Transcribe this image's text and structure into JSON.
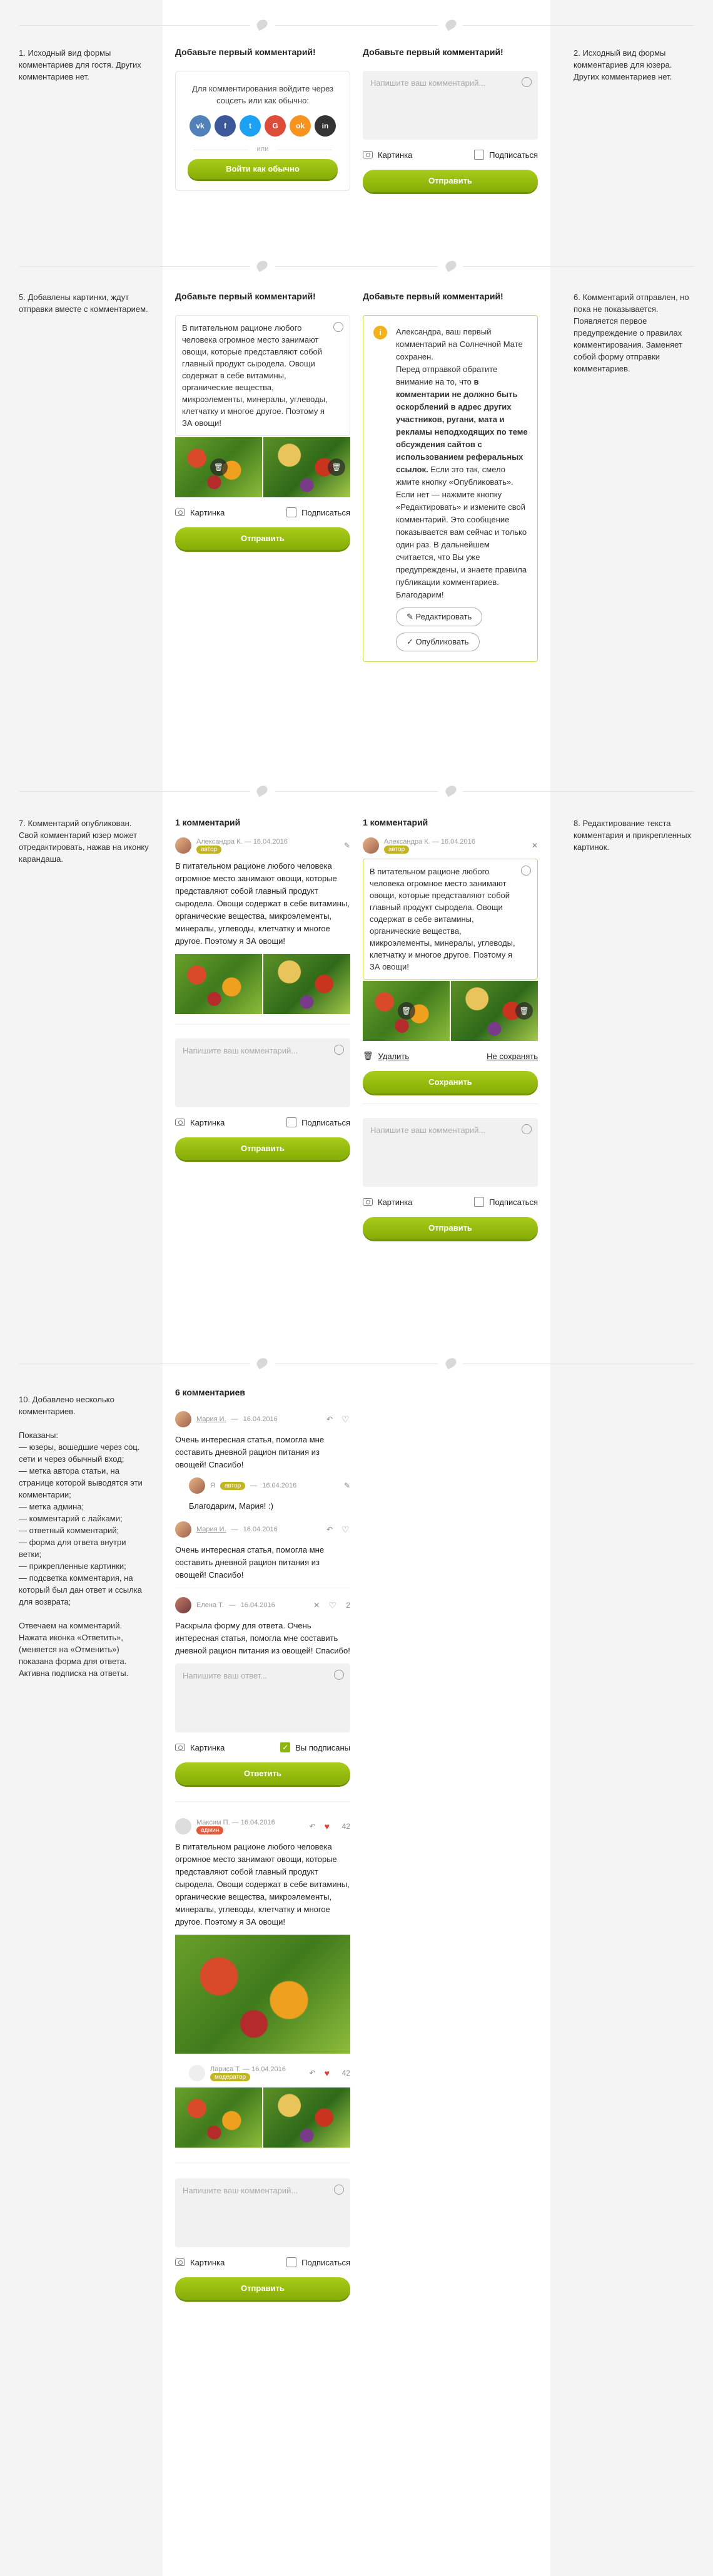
{
  "notes": {
    "n1": "1. Исходный вид формы комментариев для гостя. Других комментариев нет.",
    "n2": "2. Исходный вид формы комментариев для юзера. Других комментариев нет.",
    "n5": "5. Добавлены картинки, ждут отправки вместе с комментарием.",
    "n6": "6. Комментарий отправлен, но пока не показывается. Появляется первое предупреждение о правилах комментирования. Заменяет собой форму отправки комментариев.",
    "n7": "7. Комментарий опубликован. Свой комментарий юзер может отредактировать, нажав на иконку карандаша.",
    "n8": "8. Редактирование текста комментария и прикрепленных картинок.",
    "n10": "10. Добавлено несколько комментариев.\n\nПоказаны:\n— юзеры, вошедшие через соц. сети и через обычный вход;\n— метка автора статьи, на странице которой выводятся эти комментарии;\n— метка админа;\n— комментарий с лайками;\n— ответный комментарий;\n— форма для ответа внутри ветки;\n— прикрепленные картинки;\n— подсветка комментария, на который был дан ответ и ссылка для возврата;\n\nОтвечаем на комментарий. Нажата иконка «Ответить», (меняется на «Отменить») показана форма для ответа. Активна подписка на ответы."
  },
  "common": {
    "first_title": "Добавьте первый комментарий!",
    "placeholder": "Напишите ваш комментарий...",
    "reply_placeholder": "Напишите ваш ответ...",
    "picture": "Картинка",
    "subscribe": "Подписаться",
    "subscribed": "Вы подписаны",
    "send": "Отправить",
    "save": "Сохранить",
    "answer": "Ответить",
    "delete": "Удалить",
    "nosave": "Не сохранять",
    "edit": "Редактировать",
    "publish": "Опубликовать",
    "comment_text": "В питательном рационе любого человека огромное место занимают овощи, которые представляют собой главный продукт сыродела. Овощи содержат в себе витамины, органические вещества, микроэлементы, минералы, углеводы, клетчатку и многое другое. Поэтому я ЗА овощи!"
  },
  "guest": {
    "login_text": "Для комментирования войдите через соцсеть или как обычно:",
    "socials": [
      "vk",
      "f",
      "t",
      "G",
      "ok",
      "in"
    ],
    "or": "или",
    "login_btn": "Войти как обычно"
  },
  "warn": {
    "p1": "Александра, ваш первый комментарий на Солнечной Мате сохранен.",
    "p2a": "Перед отправкой обратите внимание на то, что ",
    "p2b": "в комментарии не должно быть оскорблений в адрес других участников, ругани, мата и рекламы неподходящих по теме обсуждения сайтов с использованием реферальных ссылок.",
    "p3": " Если это так, смело жмите кнопку «Опубликовать». Если нет — нажмите кнопку «Редактировать» и измените свой комментарий. Это сообщение показывается вам сейчас и только один раз. В дальнейшем считается, что Вы уже предупреждены, и знаете правила публикации комментариев. Благодарим!"
  },
  "published": {
    "count": "1 комментарий",
    "author": "Александра К.",
    "date": "16.04.2016",
    "badge": "автор"
  },
  "thread": {
    "count": "6 комментариев",
    "c1": {
      "author": "Мария И.",
      "date": "16.04.2016",
      "text": "Очень интересная статья, помогла мне составить дневной рацион питания из овощей! Спасибо!"
    },
    "c2": {
      "author": "Я",
      "badge": "автор",
      "date": "16.04.2016",
      "text": "Благодарим, Мария! :)"
    },
    "c3": {
      "author": "Мария И.",
      "date": "16.04.2016",
      "text": "Очень интересная статья, помогла мне составить дневной рацион питания из овощей! Спасибо!"
    },
    "c4": {
      "author": "Елена Т.",
      "date": "16.04.2016",
      "likes": "2",
      "text": "Раскрыла форму для ответа. Очень интересная статья, помогла мне составить дневной рацион питания из овощей! Спасибо!"
    },
    "c5": {
      "author": "Максим П.",
      "date": "16.04.2016",
      "badge": "админ",
      "likes": "42"
    },
    "c6": {
      "author": "Лариса Т.",
      "date": "16.04.2016",
      "badge": "модератор",
      "likes": "42"
    }
  }
}
